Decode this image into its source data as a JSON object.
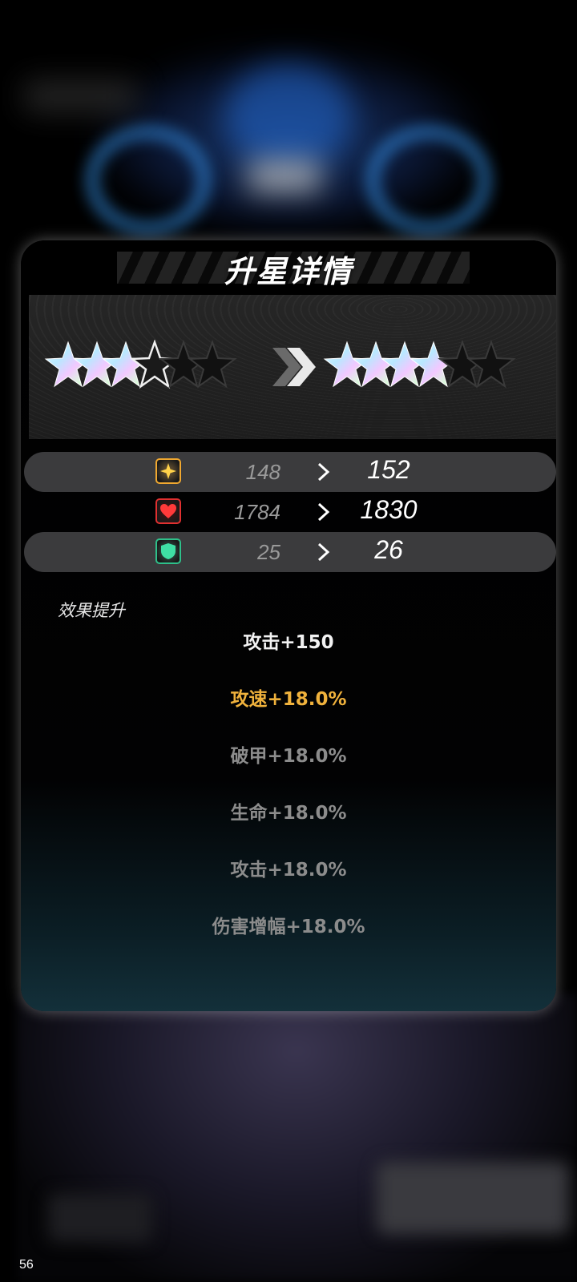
{
  "dialog": {
    "title": "升星详情"
  },
  "star_upgrade": {
    "from_stars": 3,
    "to_stars": 4,
    "max_stars": 6,
    "from_half": true
  },
  "stats": [
    {
      "icon": "attack-star-icon",
      "old": "148",
      "new": "152",
      "color": "#f0a830"
    },
    {
      "icon": "heart-icon",
      "old": "1784",
      "new": "1830",
      "color": "#e03030"
    },
    {
      "icon": "shield-icon",
      "old": "25",
      "new": "26",
      "color": "#2ec08a"
    }
  ],
  "effects": {
    "label": "效果提升",
    "items": [
      {
        "text": "攻击+150",
        "color": "#f2f2f2"
      },
      {
        "text": "攻速+18.0%",
        "color": "#f0b23c"
      },
      {
        "text": "破甲+18.0%",
        "color": "#8c8c8c"
      },
      {
        "text": "生命+18.0%",
        "color": "#8c8c8c"
      },
      {
        "text": "攻击+18.0%",
        "color": "#8c8c8c"
      },
      {
        "text": "伤害增幅+18.0%",
        "color": "#8c8c8c"
      }
    ]
  },
  "fps_counter": "56"
}
